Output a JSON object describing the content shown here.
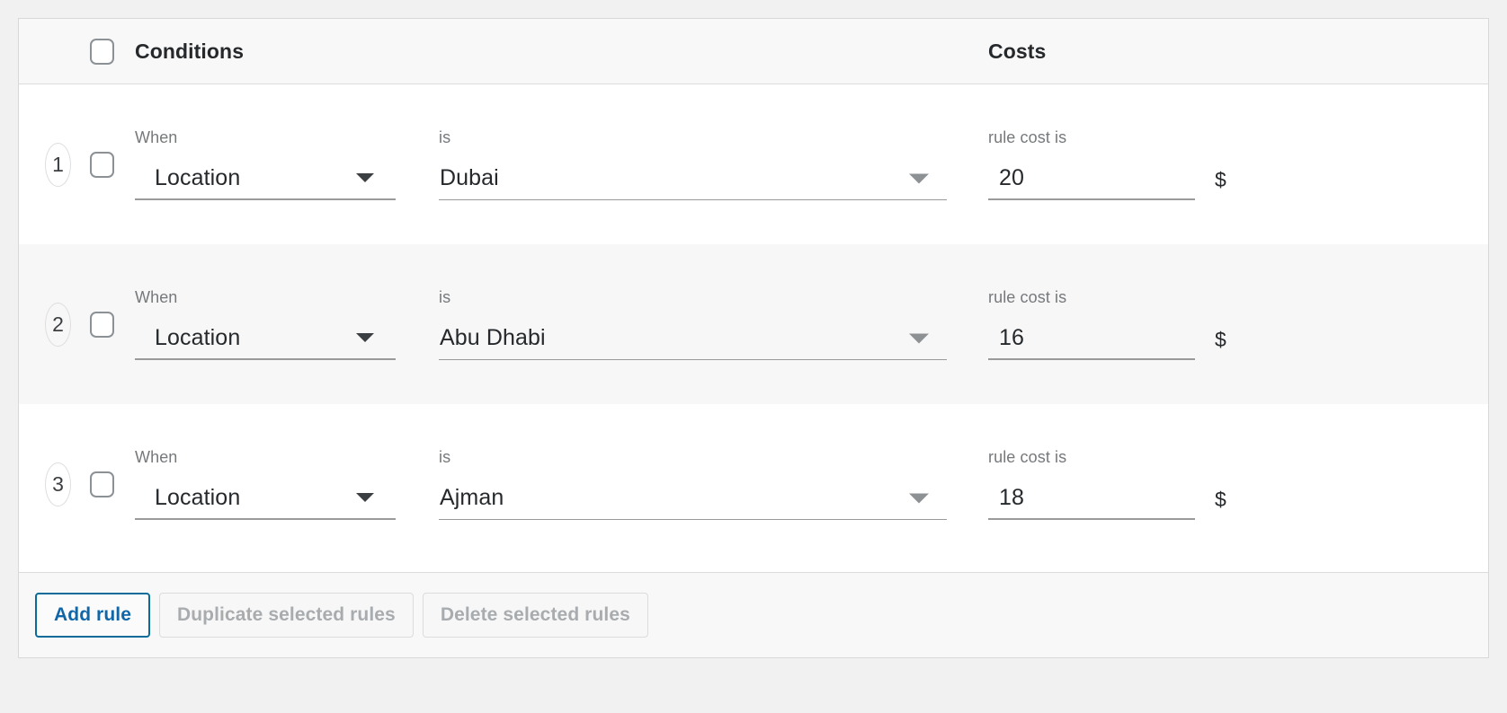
{
  "header": {
    "conditions_label": "Conditions",
    "costs_label": "Costs",
    "select_all_checkbox": "select-all"
  },
  "labels": {
    "when": "When",
    "is": "is",
    "rule_cost_is": "rule cost is",
    "currency": "$"
  },
  "rows": [
    {
      "number": "1",
      "when_value": "Location",
      "is_value": "Dubai",
      "cost_value": "20",
      "currency": "$",
      "when_label": "When",
      "is_label": "is",
      "cost_label": "rule cost is"
    },
    {
      "number": "2",
      "when_value": "Location",
      "is_value": "Abu Dhabi",
      "cost_value": "16",
      "currency": "$",
      "when_label": "When",
      "is_label": "is",
      "cost_label": "rule cost is"
    },
    {
      "number": "3",
      "when_value": "Location",
      "is_value": "Ajman",
      "cost_value": "18",
      "currency": "$",
      "when_label": "When",
      "is_label": "is",
      "cost_label": "rule cost is"
    }
  ],
  "footer": {
    "add_rule": "Add rule",
    "duplicate_selected": "Duplicate selected rules",
    "delete_selected": "Delete selected rules"
  },
  "colors": {
    "primary": "#1166a8",
    "primary_border": "#0a6c9a",
    "disabled_text": "#a9acaf",
    "text": "#26292c",
    "muted_text": "#76797c",
    "row_alt_bg": "#f7f7f7",
    "header_bg": "#f8f8f8",
    "border": "#dcdcdc"
  }
}
